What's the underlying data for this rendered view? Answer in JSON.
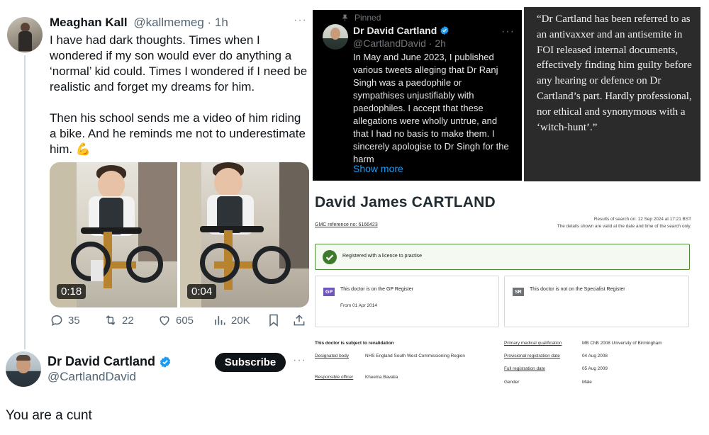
{
  "left_tweet": {
    "author_name": "Meaghan Kall",
    "author_handle": "@kallmemeg",
    "time": "· 1h",
    "menu": "···",
    "body": "I have had dark thoughts. Times when I wondered if my son would ever do anything a ‘normal’ kid could. Times I wondered if I need be realistic and forget my dreams for him.\n\nThen his school sends me a video of him riding a bike. And he reminds me not to underestimate him.",
    "emoji": "💪",
    "videos": [
      {
        "duration": "0:18"
      },
      {
        "duration": "0:04"
      }
    ],
    "stats": {
      "replies": "35",
      "retweets": "22",
      "likes": "605",
      "views": "20K"
    }
  },
  "reply": {
    "author_name": "Dr David Cartland",
    "author_handle": "@CartlandDavid",
    "subscribe_label": "Subscribe",
    "menu": "···",
    "text": "You are a cunt"
  },
  "pinned_tweet": {
    "pinned_label": "Pinned",
    "author_name": "Dr David Cartland",
    "author_handle": "@CartlandDavid · 2h",
    "menu": "···",
    "body": "In May and June 2023, I published various tweets alleging that Dr Ranj Singh was a paedophile or sympathises unjustifiably with paedophiles. I accept that these allegations were wholly untrue, and that I had no basis to make them. I sincerely apologise to Dr Singh for the harm",
    "show_more": "Show more"
  },
  "quote": {
    "text": "“Dr Cartland has been referred to as an antivaxxer and an antisemite in FOI released internal documents, effectively finding him guilty before any hearing or defence on Dr Cartland’s part. Hardly professional, nor ethical and synonymous with a ‘witch-hunt’.”"
  },
  "gmc": {
    "name": "David James CARTLAND",
    "ref": "GMC reference no: 6166423",
    "search_date": "Results of search on: 12 Sep 2024 at 17:21 BST",
    "search_note": "The details shown are valid at the date and time of the search only.",
    "licence": "Registered with a licence to practise",
    "gp": {
      "badge": "GP",
      "title": "This doctor is on the GP Register",
      "sub": "From 01 Apr 2014"
    },
    "sr": {
      "badge": "SR",
      "title": "This doctor is not on the Specialist Register"
    },
    "revalidation_heading": "This doctor is subject to revalidation",
    "designated_body_label": "Designated body",
    "designated_body_value": "NHS England South West Commissioning Region",
    "responsible_officer_label": "Responsible officer",
    "responsible_officer_value": "Kheelna Bavalia",
    "primary_qual_label": "Primary medical qualification",
    "primary_qual_value": "MB ChB 2008 University of Birmingham",
    "prov_reg_label": "Provisional registration date",
    "prov_reg_value": "04 Aug 2008",
    "full_reg_label": "Full registration date",
    "full_reg_value": "05 Aug 2009",
    "gender_label": "Gender",
    "gender_value": "Male"
  },
  "colors": {
    "verified": "#1d9bf0",
    "x_dark": "#000000",
    "link_blue": "#1d9bf0",
    "gmc_green": "#3d7a2c",
    "gp_badge": "#6f56b8"
  },
  "icons": [
    "reply-icon",
    "retweet-icon",
    "like-icon",
    "views-icon",
    "bookmark-icon",
    "share-icon",
    "verified-badge-icon",
    "pin-icon",
    "check-icon"
  ]
}
